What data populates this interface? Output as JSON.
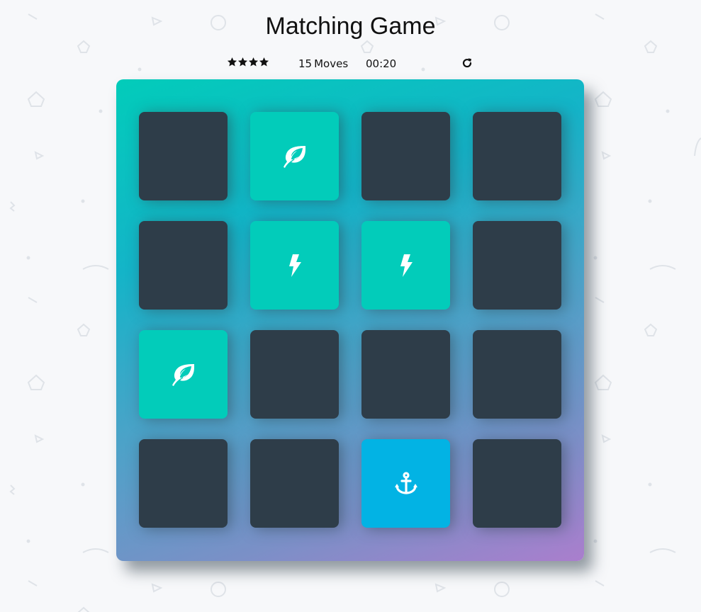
{
  "title": "Matching Game",
  "score": {
    "stars": 4,
    "moves_count": "15",
    "moves_label": "Moves",
    "timer": "00:20",
    "restart_icon": "restart-icon"
  },
  "colors": {
    "card_closed": "#2e3d49",
    "card_match": "#02ccba",
    "card_open": "#02b3e4",
    "deck_gradient_start": "#02ccba",
    "deck_gradient_end": "#aa7ecd"
  },
  "cards": [
    {
      "state": "closed",
      "icon": ""
    },
    {
      "state": "match",
      "icon": "leaf"
    },
    {
      "state": "closed",
      "icon": ""
    },
    {
      "state": "closed",
      "icon": ""
    },
    {
      "state": "closed",
      "icon": ""
    },
    {
      "state": "match",
      "icon": "bolt"
    },
    {
      "state": "match",
      "icon": "bolt"
    },
    {
      "state": "closed",
      "icon": ""
    },
    {
      "state": "match",
      "icon": "leaf"
    },
    {
      "state": "closed",
      "icon": ""
    },
    {
      "state": "closed",
      "icon": ""
    },
    {
      "state": "closed",
      "icon": ""
    },
    {
      "state": "closed",
      "icon": ""
    },
    {
      "state": "closed",
      "icon": ""
    },
    {
      "state": "open",
      "icon": "anchor"
    },
    {
      "state": "closed",
      "icon": ""
    }
  ]
}
